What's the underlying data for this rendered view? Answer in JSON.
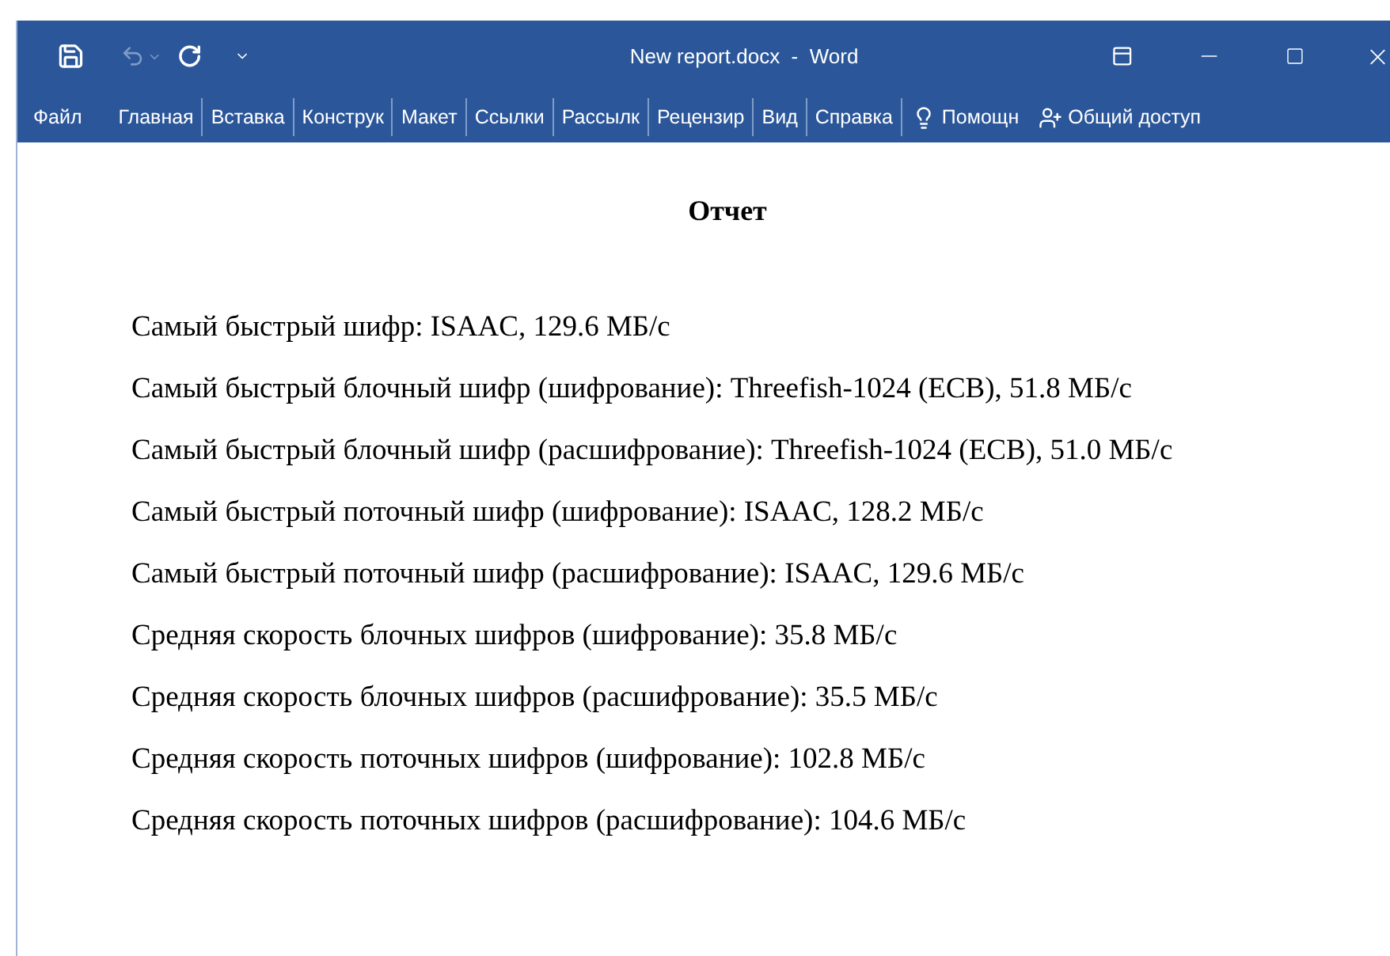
{
  "window": {
    "title": "New report.docx  -  Word"
  },
  "ribbon_tabs": [
    {
      "label": "Файл",
      "kind": "file"
    },
    {
      "label": "Главная",
      "kind": "tab"
    },
    {
      "label": "Вставка",
      "kind": "tab"
    },
    {
      "label": "Конструк",
      "kind": "tab"
    },
    {
      "label": "Макет",
      "kind": "tab"
    },
    {
      "label": "Ссылки",
      "kind": "tab"
    },
    {
      "label": "Рассылк",
      "kind": "tab"
    },
    {
      "label": "Рецензир",
      "kind": "tab"
    },
    {
      "label": "Вид",
      "kind": "tab"
    },
    {
      "label": "Справка",
      "kind": "tab"
    },
    {
      "label": "Помощн",
      "kind": "help"
    },
    {
      "label": "Общий доступ",
      "kind": "share"
    }
  ],
  "document": {
    "heading": "Отчет",
    "paragraphs": [
      "Самый быстрый шифр: ISAAC, 129.6 МБ/с",
      "Самый быстрый блочный шифр (шифрование): Threefish-1024 (ECB), 51.8 МБ/с",
      "Самый быстрый блочный шифр (расшифрование): Threefish-1024 (ECB), 51.0 МБ/с",
      "Самый быстрый поточный шифр (шифрование): ISAAC, 128.2 МБ/с",
      "Самый быстрый поточный шифр (расшифрование): ISAAC, 129.6 МБ/с",
      "Средняя скорость блочных шифров (шифрование): 35.8 МБ/с",
      "Средняя скорость блочных шифров (расшифрование): 35.5 МБ/с",
      "Средняя скорость поточных шифров (шифрование): 102.8 МБ/с",
      "Средняя скорость поточных шифров (расшифрование): 104.6 МБ/с"
    ]
  }
}
